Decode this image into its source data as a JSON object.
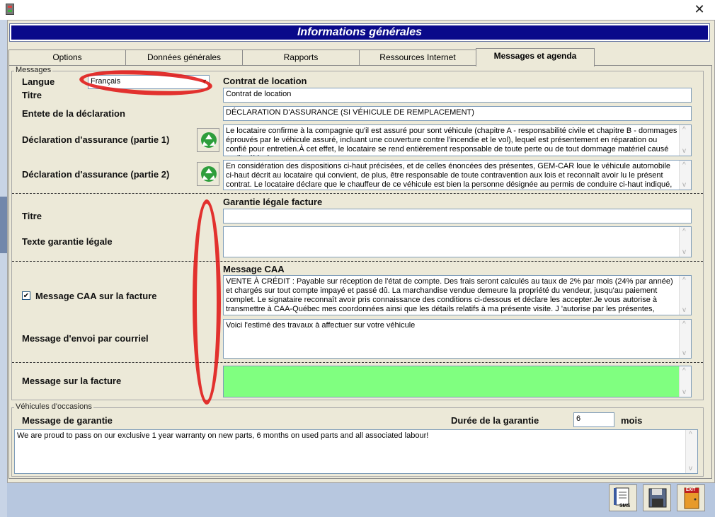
{
  "window": {
    "title": "Informations générales"
  },
  "tabs": [
    {
      "label": "Options"
    },
    {
      "label": "Données générales"
    },
    {
      "label": "Rapports"
    },
    {
      "label": "Ressources Internet"
    },
    {
      "label": "Messages et agenda"
    }
  ],
  "messages_group": {
    "label": "Messages"
  },
  "langue": {
    "label": "Langue",
    "value": "Français"
  },
  "contrat": {
    "header": "Contrat de location",
    "titre_label": "Titre",
    "titre_value": "Contrat de location",
    "entete_label": "Entete de la déclaration",
    "entete_value": "DÉCLARATION D'ASSURANCE (SI VÉHICULE DE REMPLACEMENT)",
    "decl1_label": "Déclaration d'assurance (partie 1)",
    "decl1_value": "Le locataire confirme à la compagnie qu'il est assuré pour sont véhicule (chapitre A - responsabilité civile et chapitre B - dommages éprouvés par le véhicule assuré, incluant une couverture contre l'incendie et le vol), lequel est présentement en réparation ou confié pour entretien.À cet effet, le locataire se rend entièrement responsable de toute perte ou de tout dommage matériel causé audit véhicule",
    "decl2_label": "Déclaration d'assurance (partie 2)",
    "decl2_value": "En considération des dispositions ci-haut précisées, et de celles énoncées des présentes, GEM-CAR loue le véhicule automobile ci-haut décrit au locataire qui convient, de plus, être responsable de toute contravention aux lois et reconnaît avoir lu le présent contrat. Le locataire déclare que le chauffeur de ce véhicule est bien la personne désignée au permis de conduire ci-haut indiqué, et que cette"
  },
  "garantie": {
    "header": "Garantie légale facture",
    "titre_label": "Titre",
    "titre_value": "",
    "texte_label": "Texte garantie légale",
    "texte_value": ""
  },
  "caa": {
    "header": "Message CAA",
    "checkbox_label": "Message CAA sur la facture",
    "checked": "✔",
    "value": "VENTE À CRÉDIT : Payable sur réception de l'état de compte. Des frais seront calculés au taux de 2% par mois (24% par année) et chargés sur tout compte impayé et passé dû. La marchandise vendue demeure la propriété du vendeur, jusqu'au paiement complet. Le signataire reconnaît avoir pris connaissance des conditions ci-dessous et déclare les accepter.Je vous autorise à transmettre à CAA-Québec mes coordonnées ainsi que les détails relatifs à ma présente visite. J 'autorise par les présentes, l'ouverture et la constitution",
    "courriel_label": "Message d'envoi par courriel",
    "courriel_value": "Voici l'estimé des travaux à affectuer sur votre véhicule"
  },
  "facture": {
    "label": "Message sur la facture",
    "value": ""
  },
  "vehicules_group": {
    "label": "Véhicules d'occasions",
    "garantie_label": "Message de garantie",
    "duree_label": "Durée de la garantie",
    "duree_value": "6",
    "mois_label": "mois",
    "garantie_value": "We are proud to pass on our exclusive 1 year warranty on new parts, 6 months on used parts and all associated labour!"
  },
  "toolbar": {
    "sms": "SMS",
    "exit": "EXIT"
  },
  "colors": {
    "banner": "#0a0a8a",
    "highlight_field": "#80ff80",
    "annotation": "#e01010"
  },
  "icons": [
    "app-icon",
    "close-icon",
    "recycle-icon",
    "sms-icon",
    "save-icon",
    "exit-icon"
  ]
}
